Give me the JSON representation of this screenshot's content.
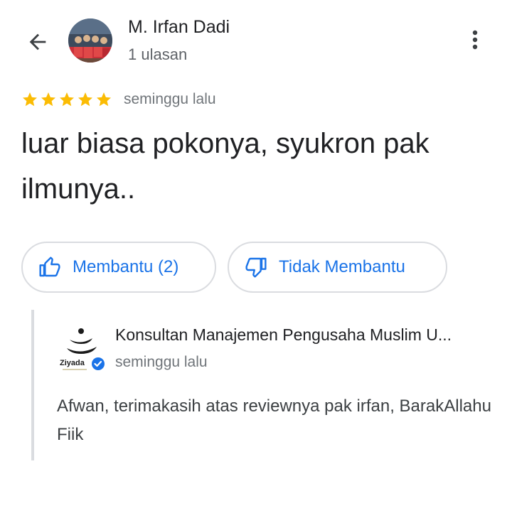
{
  "header": {
    "reviewer_name": "M. Irfan Dadi",
    "reviewer_meta": "1 ulasan"
  },
  "review": {
    "rating": 5,
    "rating_max": 5,
    "time": "seminggu lalu",
    "text": "luar biasa pokonya, syukron pak ilmunya.."
  },
  "actions": {
    "helpful_label": "Membantu (2)",
    "not_helpful_label": "Tidak Membantu"
  },
  "owner_reply": {
    "owner_name": "Konsultan Manajemen Pengusaha Muslim U...",
    "logo_text": "Ziyada",
    "time": "seminggu lalu",
    "text": "Afwan, terimakasih atas reviewnya pak irfan, BarakAllahu Fiik"
  },
  "colors": {
    "star": "#fbbc04",
    "accent": "#1a73e8",
    "verified": "#1a73e8"
  },
  "icons": [
    "back-arrow-icon",
    "more-vert-icon",
    "star-icon",
    "thumbs-up-icon",
    "thumbs-down-icon",
    "verified-badge-icon"
  ]
}
